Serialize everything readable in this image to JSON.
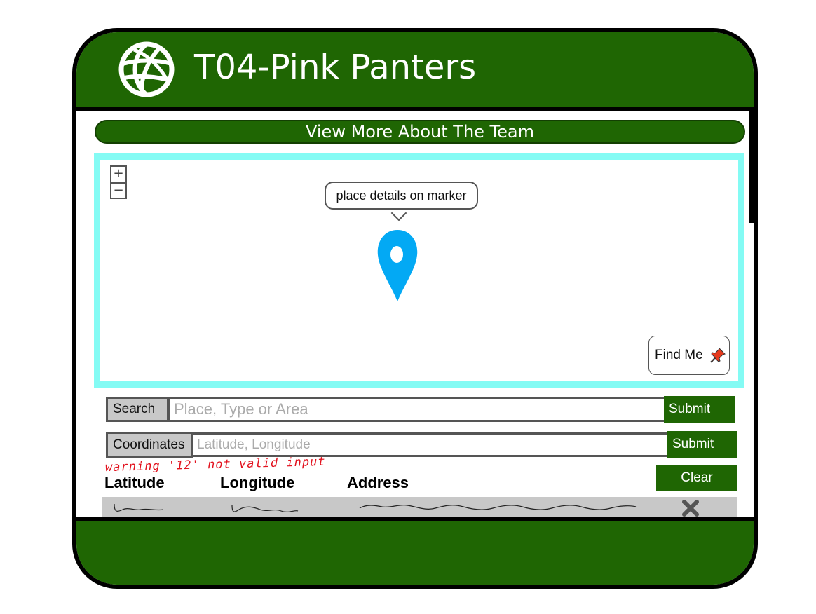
{
  "header": {
    "title": "T04-Pink Panters",
    "logo_icon": "globe-icon"
  },
  "team_link": {
    "label": "View More About The Team"
  },
  "map": {
    "zoom_in_label": "+",
    "zoom_out_label": "−",
    "marker_popup": "place details on marker",
    "marker_icon": "map-marker-icon",
    "find_me_label": "Find Me",
    "find_me_icon": "pushpin-icon"
  },
  "search": {
    "label": "Search",
    "placeholder": "Place, Type or Area",
    "submit_label": "Submit"
  },
  "coordinates": {
    "label": "Coordinates",
    "placeholder": "Latitude, Longitude",
    "submit_label": "Submit",
    "warning": "warning '12' not valid input"
  },
  "results": {
    "clear_label": "Clear",
    "columns": [
      "Latitude",
      "Longitude",
      "Address"
    ],
    "remove_icon": "close-icon"
  },
  "colors": {
    "brand_green": "#1f6603",
    "map_border": "#84fbf4",
    "marker_blue": "#03a9f4",
    "warning_red": "#e2121e"
  }
}
